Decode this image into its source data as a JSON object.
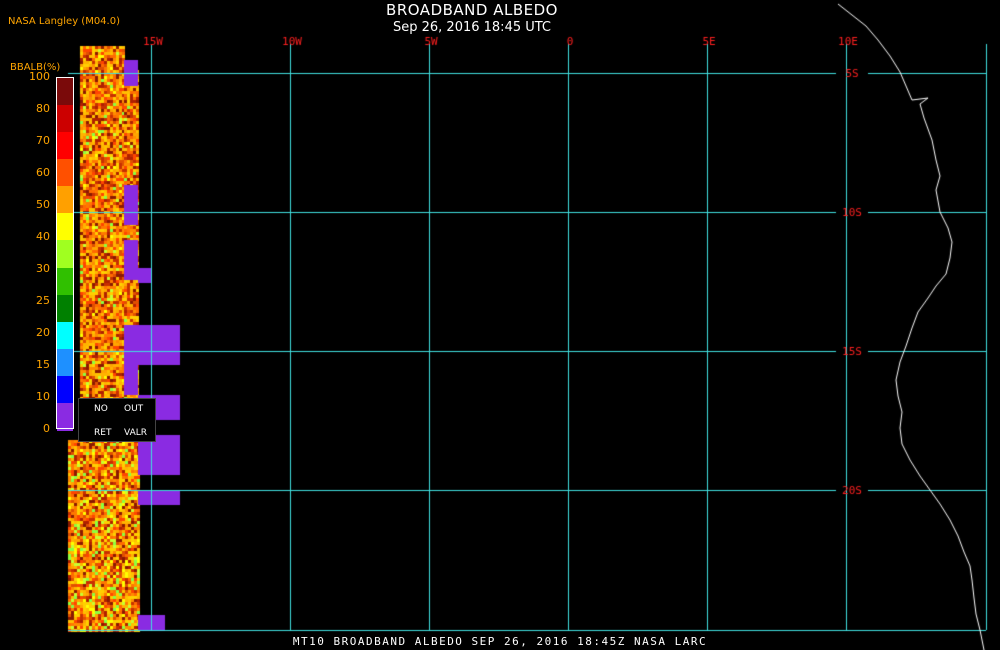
{
  "header": {
    "title": "BROADBAND ALBEDO",
    "datetime": "Sep 26, 2016 18:45 UTC",
    "brand": "NASA Langley (M04.0)"
  },
  "footer": {
    "caption": "MT10   BROADBAND ALBEDO   SEP 26, 2016 18:45Z   NASA LARC"
  },
  "map": {
    "longitude_labels": [
      "15W",
      "10W",
      "5W",
      "0",
      "5E",
      "10E"
    ],
    "longitudes": [
      -15,
      -10,
      -5,
      0,
      5,
      10
    ],
    "latitude_labels": [
      "5S",
      "10S",
      "15S",
      "20S"
    ],
    "latitudes": [
      -5,
      -10,
      -15,
      -20
    ],
    "grid_color": "#40e0e0",
    "label_color": "#ff2020",
    "coast_color": "#ffffff"
  },
  "legend": {
    "title": "BBALB(%)",
    "ticks": [
      "100",
      "80",
      "70",
      "60",
      "50",
      "40",
      "30",
      "25",
      "20",
      "15",
      "10",
      "0"
    ],
    "colors": [
      "#7a0a0a",
      "#cc0000",
      "#ff0000",
      "#ff5000",
      "#ffa000",
      "#ffff00",
      "#a0ff20",
      "#30c000",
      "#008000",
      "#00ffff",
      "#1e90ff",
      "#0000ff",
      "#8a2be2"
    ],
    "no_retrieval": [
      "NO",
      "RET"
    ],
    "out_of_range": [
      "OUT",
      "VALR"
    ],
    "no_retrieval_color": "#8a2be2"
  }
}
